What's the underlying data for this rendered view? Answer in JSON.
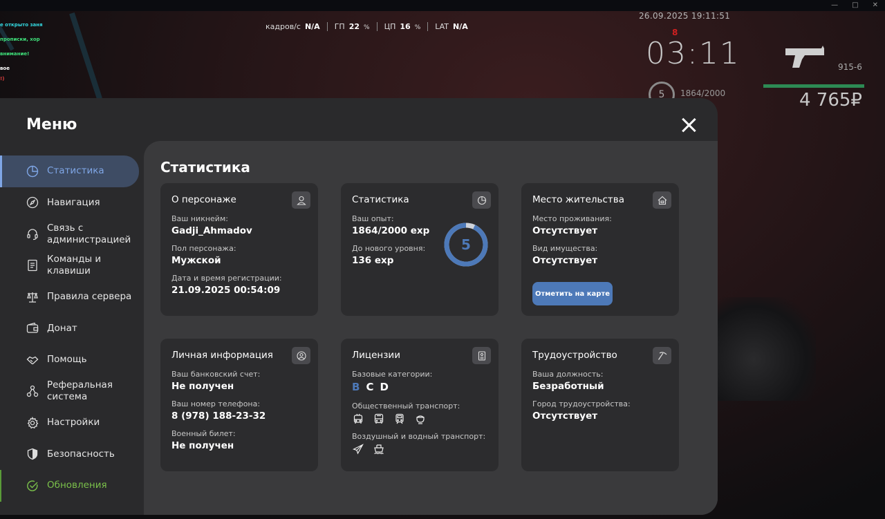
{
  "window": {
    "controls": [
      "—",
      "□",
      "✕"
    ]
  },
  "chat": {
    "lines": [
      "е открыто заня",
      "прописки, хор",
      "внимание!",
      "вое",
      "!)"
    ]
  },
  "perf": {
    "fps_label": "кадров/с",
    "fps_value": "N/A",
    "gpu_label": "ГП",
    "gpu_value": "22",
    "gpu_unit": "%",
    "cpu_label": "ЦП",
    "cpu_value": "16",
    "cpu_unit": "%",
    "lat_label": "LAT",
    "lat_value": "N/A"
  },
  "hud": {
    "datetime": "26.09.2025 19:11:51",
    "mark": "8",
    "time": "03:11",
    "level": "5",
    "exp": "1864/2000",
    "ammo": "915-6",
    "money": "4 765₽"
  },
  "menu": {
    "title": "Меню",
    "items": [
      {
        "label": "Статистика",
        "icon": "pie-chart-icon"
      },
      {
        "label": "Навигация",
        "icon": "compass-icon"
      },
      {
        "label": "Связь с администрацией",
        "icon": "headset-icon"
      },
      {
        "label": "Команды и клавиши",
        "icon": "list-doc-icon"
      },
      {
        "label": "Правила сервера",
        "icon": "scales-icon"
      },
      {
        "label": "Донат",
        "icon": "wallet-icon"
      },
      {
        "label": "Помощь",
        "icon": "handshake-icon"
      },
      {
        "label": "Реферальная система",
        "icon": "network-icon"
      },
      {
        "label": "Настройки",
        "icon": "gear-icon"
      },
      {
        "label": "Безопасность",
        "icon": "shield-icon"
      },
      {
        "label": "Обновления",
        "icon": "check-circle-icon"
      }
    ]
  },
  "content": {
    "title": "Статистика",
    "character": {
      "title": "О персонаже",
      "nick_label": "Ваш никнейм:",
      "nick": "Gadji_Ahmadov",
      "gender_label": "Пол персонажа:",
      "gender": "Мужской",
      "reg_label": "Дата и время регистрации:",
      "reg": "21.09.2025 00:54:09"
    },
    "stats": {
      "title": "Статистика",
      "exp_label": "Ваш опыт:",
      "exp": "1864/2000 exp",
      "next_label": "До нового уровня:",
      "next": "136 exp",
      "level": "5",
      "progress": 0.932
    },
    "residence": {
      "title": "Место жительства",
      "place_label": "Место проживания:",
      "place": "Отсутствует",
      "property_label": "Вид имущества:",
      "property": "Отсутствует",
      "button": "Отметить на карте"
    },
    "personal": {
      "title": "Личная информация",
      "bank_label": "Ваш банковский счет:",
      "bank": "Не получен",
      "phone_label": "Ваш номер телефона:",
      "phone": "8 (978) 188-23-32",
      "military_label": "Военный билет:",
      "military": "Не получен"
    },
    "licenses": {
      "title": "Лицензии",
      "base_label": "Базовые категории:",
      "base": [
        "B",
        "C",
        "D"
      ],
      "public_label": "Общественный транспорт:",
      "air_label": "Воздушный и водный транспорт:"
    },
    "job": {
      "title": "Трудоустройство",
      "position_label": "Ваша должность:",
      "position": "Безработный",
      "city_label": "Город трудоустройства:",
      "city": "Отсутствует"
    }
  },
  "colors": {
    "accent": "#4d79b8",
    "active_text": "#7fa6e6",
    "update_green": "#7ac04a"
  }
}
